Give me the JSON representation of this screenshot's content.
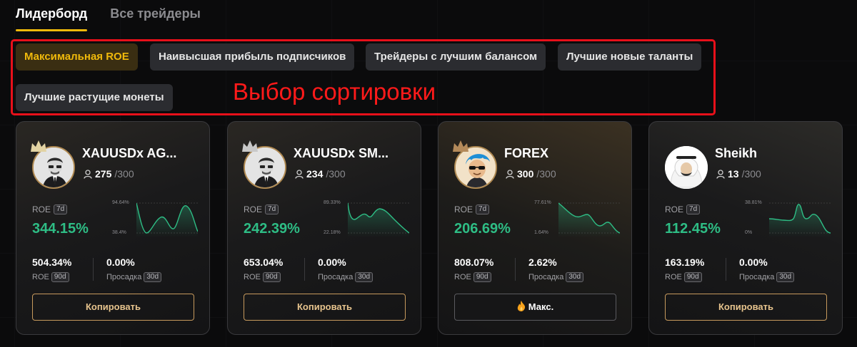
{
  "tabs": [
    {
      "label": "Лидерборд",
      "active": true
    },
    {
      "label": "Все трейдеры",
      "active": false
    }
  ],
  "sort": {
    "options": [
      {
        "label": "Максимальная ROE",
        "active": true
      },
      {
        "label": "Наивысшая прибыль подписчиков",
        "active": false
      },
      {
        "label": "Трейдеры с лучшим балансом",
        "active": false
      },
      {
        "label": "Лучшие новые таланты",
        "active": false
      },
      {
        "label": "Лучшие растущие монеты",
        "active": false
      }
    ],
    "annotation": "Выбор сортировки"
  },
  "common": {
    "roe_label": "ROE",
    "period_7d": "7d",
    "period_90d": "90d",
    "period_30d": "30d",
    "drawdown_label": "Просадка",
    "copy_label": "Копировать",
    "max_label": "Макс."
  },
  "colors": {
    "accent": "#f0b90b",
    "positive": "#2ebd85",
    "annotation": "#e8101a"
  },
  "cards": [
    {
      "name": "XAUUSDx AG...",
      "followers": "275",
      "followers_max": "/300",
      "roe": "344.15%",
      "spark_max": "94.64%",
      "spark_min": "38.4%",
      "roe_90d": "504.34%",
      "drawdown": "0.00%",
      "button": "copy",
      "avatar": "avatar-suit-icon",
      "crown": true
    },
    {
      "name": "XAUUSDx SM...",
      "followers": "234",
      "followers_max": "/300",
      "roe": "242.39%",
      "spark_max": "89.33%",
      "spark_min": "22.18%",
      "roe_90d": "653.04%",
      "drawdown": "0.00%",
      "button": "copy",
      "avatar": "avatar-suit-icon",
      "crown": true
    },
    {
      "name": "FOREX",
      "followers": "300",
      "followers_max": "/300",
      "roe": "206.69%",
      "spark_max": "77.61%",
      "spark_min": "1.64%",
      "roe_90d": "808.07%",
      "drawdown": "2.62%",
      "button": "max",
      "avatar": "avatar-blue-hair-icon",
      "crown": true
    },
    {
      "name": "Sheikh",
      "followers": "13",
      "followers_max": "/300",
      "roe": "112.45%",
      "spark_max": "38.81%",
      "spark_min": "0%",
      "roe_90d": "163.19%",
      "drawdown": "0.00%",
      "button": "copy",
      "avatar": "avatar-sheikh-icon",
      "crown": false
    }
  ]
}
